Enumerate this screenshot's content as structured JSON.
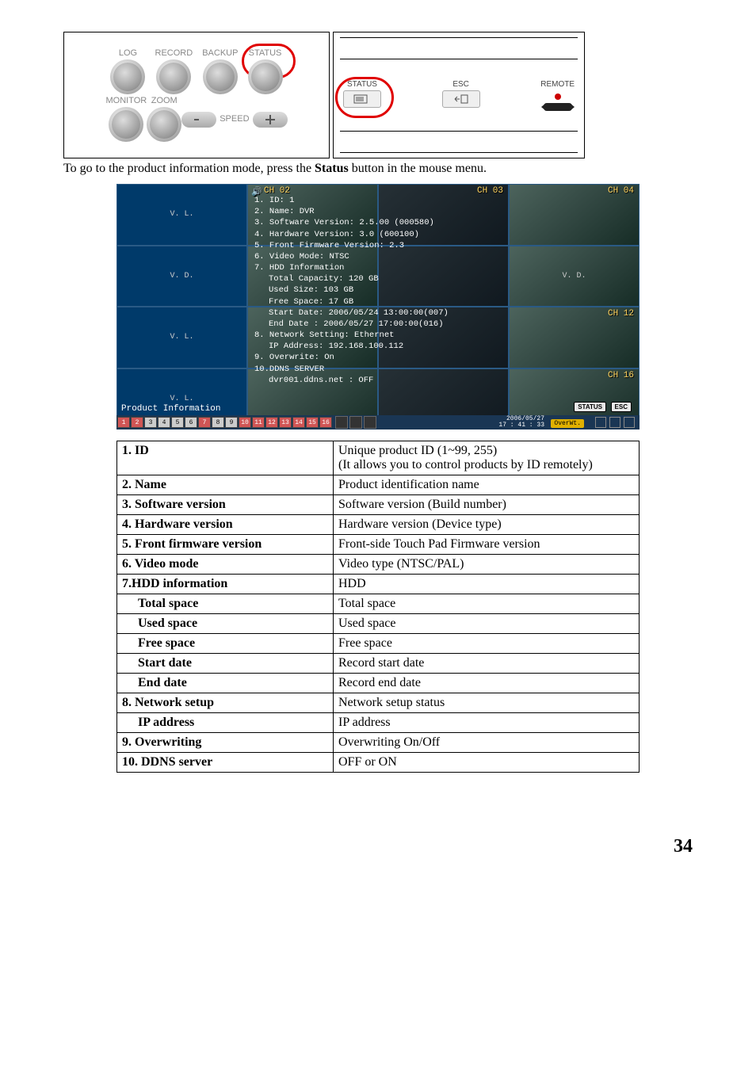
{
  "dial_labels": {
    "log": "LOG",
    "record": "RECORD",
    "backup": "BACKUP",
    "status": "STATUS",
    "monitor": "MONITOR",
    "zoom": "ZOOM",
    "speed": "SPEED"
  },
  "remote_labels": {
    "status": "STATUS",
    "esc": "ESC",
    "remote": "REMOTE"
  },
  "caption": {
    "prefix": "To go to the product information mode, press the ",
    "bold": "Status",
    "suffix": " button in the mouse menu."
  },
  "product_info_panel": {
    "lines": [
      "1. ID: 1",
      "2. Name: DVR",
      "3. Software Version: 2.5.00 (000580)",
      "4. Hardware Version: 3.0 (600100)",
      "5. Front Firmware Version: 2.3",
      "6. Video Mode: NTSC",
      "7. HDD Information"
    ],
    "sublines_hdd": [
      "Total Capacity: 120 GB",
      "Used Size: 103 GB",
      "Free Space: 17 GB",
      "Start Date: 2006/05/24 13:00:00(007)",
      "End Date  : 2006/05/27 17:00:00(016)"
    ],
    "line_net": "8. Network Setting: Ethernet",
    "subline_ip": "IP Address: 192.168.100.112",
    "line_overwrite": "9. Overwrite: On",
    "line_ddns": "10.DDNS SERVER",
    "subline_ddns": "dvr001.ddns.net : OFF"
  },
  "product_info_screen": {
    "title_label": "Product Information",
    "ch_loss": "V. L.",
    "ch_detect": "V. D.",
    "ch_speaker_icon": "🔊",
    "channels_labeled": {
      "2": "CH 02",
      "3": "CH 03",
      "4": "CH 04",
      "12": "CH 12",
      "16": "CH 16"
    },
    "status_btn": "STATUS",
    "esc_btn": "ESC",
    "overwt": "OverWt.",
    "datetime_line1": "2006/05/27",
    "datetime_line2": "17 : 41 : 33"
  },
  "table_rows": [
    {
      "label": "1. ID",
      "indent": 0,
      "value": "Unique product ID (1~99, 255)\n(It allows you to control products by ID remotely)"
    },
    {
      "label": "2. Name",
      "indent": 0,
      "value": "Product identification name"
    },
    {
      "label": "3. Software version",
      "indent": 0,
      "value": "Software version (Build number)"
    },
    {
      "label": "4. Hardware version",
      "indent": 0,
      "value": "Hardware version (Device type)"
    },
    {
      "label": "5. Front firmware version",
      "indent": 0,
      "value": "Front-side Touch Pad Firmware version"
    },
    {
      "label": "6. Video mode",
      "indent": 0,
      "value": "Video type (NTSC/PAL)"
    },
    {
      "label": "7.HDD information",
      "indent": 0,
      "value": "HDD"
    },
    {
      "label": "Total space",
      "indent": 1,
      "value": "Total space"
    },
    {
      "label": "Used space",
      "indent": 1,
      "value": "Used space"
    },
    {
      "label": "Free space",
      "indent": 1,
      "value": "Free space"
    },
    {
      "label": "Start date",
      "indent": 1,
      "value": "Record start date"
    },
    {
      "label": "End date",
      "indent": 1,
      "value": "Record end date"
    },
    {
      "label": "8. Network setup",
      "indent": 0,
      "value": "Network setup status"
    },
    {
      "label": "IP address",
      "indent": 1,
      "value": "IP address"
    },
    {
      "label": "9. Overwriting",
      "indent": 0,
      "value": "Overwriting On/Off"
    },
    {
      "label": "10. DDNS server",
      "indent": 0,
      "value": "OFF or ON"
    }
  ],
  "page_number": "34"
}
